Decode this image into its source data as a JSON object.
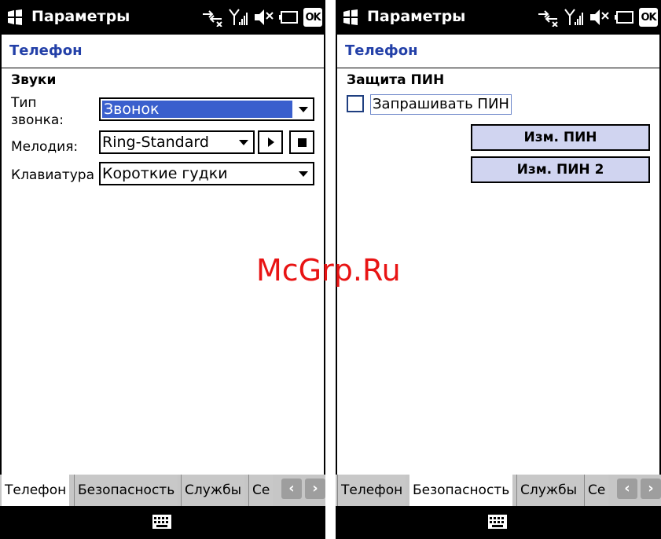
{
  "watermark": "McGrp.Ru",
  "colors": {
    "accent": "#2340a8",
    "selection": "#3a5fcd",
    "button_fill": "#d0d4f0",
    "watermark": "#e81414"
  },
  "panels": [
    {
      "titlebar": {
        "app_title": "Параметры",
        "ok_label": "OK"
      },
      "page_header": "Телефон",
      "section_title": "Звуки",
      "fields": {
        "ring_type": {
          "label_line1": "Тип",
          "label_line2": "звонка:",
          "value": "Звонок"
        },
        "melody": {
          "label": "Мелодия:",
          "value": "Ring-Standard"
        },
        "keyboard": {
          "label": "Клавиатура",
          "value": "Короткие гудки"
        }
      },
      "tabs": [
        "Телефон",
        "Безопасность",
        "Службы",
        "Се"
      ],
      "active_tab": "Телефон"
    },
    {
      "titlebar": {
        "app_title": "Параметры",
        "ok_label": "OK"
      },
      "page_header": "Телефон",
      "section_title": "Защита ПИН",
      "checkbox": {
        "label": "Запрашивать ПИН",
        "checked": false
      },
      "buttons": {
        "change_pin": "Изм. ПИН",
        "change_pin2": "Изм. ПИН 2"
      },
      "tabs": [
        "Телефон",
        "Безопасность",
        "Службы",
        "Се"
      ],
      "active_tab": "Безопасность"
    }
  ],
  "icons": [
    "windows-flag-icon",
    "connectivity-icon",
    "signal-icon",
    "volume-mute-icon",
    "battery-icon",
    "keyboard-icon",
    "chevron-left-icon",
    "chevron-right-icon",
    "play-icon",
    "stop-icon"
  ]
}
